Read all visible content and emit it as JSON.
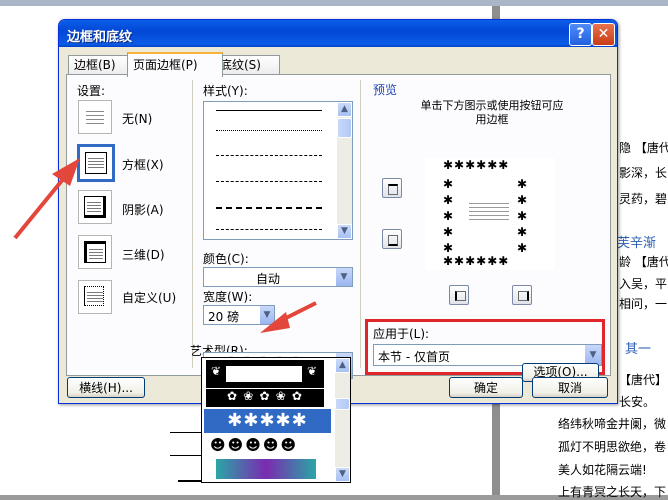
{
  "background_doc": {
    "lines": [
      "隐 【唐代",
      "影深，长",
      "灵药，碧",
      "龄 【唐代",
      "入吴，平",
      "相问，一",
      "【唐代】",
      "长安。",
      "络纬秋啼金井阑，微",
      "孤灯不明思欲绝，卷",
      "美人如花隔云端!",
      "上有青冥之长天，下"
    ],
    "headings": [
      "芙辛渐",
      "其一"
    ]
  },
  "dialog": {
    "title": "边框和底纹",
    "help_label": "?",
    "close_label": "✕",
    "tabs": [
      "边框(B)",
      "页面边框(P)",
      "底纹(S)"
    ],
    "settings": {
      "label": "设置:",
      "items": [
        "无(N)",
        "方框(X)",
        "阴影(A)",
        "三维(D)",
        "自定义(U)"
      ],
      "selected": "方框(X)"
    },
    "style_label": "样式(Y):",
    "color_label": "颜色(C):",
    "color_value": "自动",
    "width_label": "宽度(W):",
    "width_value": "20 磅",
    "art_label": "艺术型(R):",
    "art_value": "✱✱✱✱✱",
    "preview": {
      "label": "预览",
      "hint": "单击下方图示或使用按钮可应用边框"
    },
    "apply_label": "应用于(L):",
    "apply_value": "本节 - 仅首页",
    "options_button": "选项(O)...",
    "horizontal_line_button": "横线(H)...",
    "ok_button": "确定",
    "cancel_button": "取消"
  },
  "colors": {
    "selection_blue": "#316ac5",
    "highlight_red": "#e0262a",
    "arrow_red": "#e3463a",
    "xp_title_blue": "#0a5fe8"
  }
}
